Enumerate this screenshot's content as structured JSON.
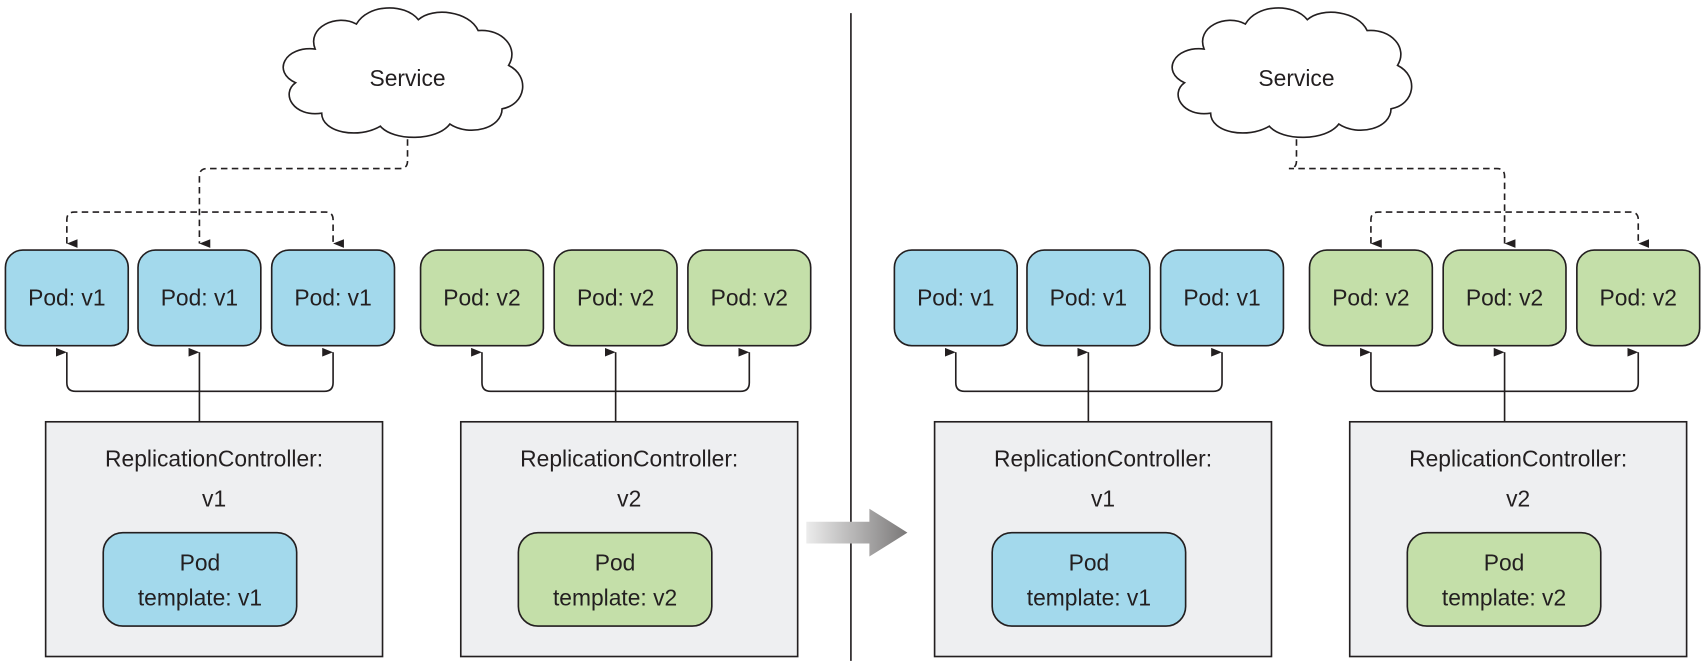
{
  "colors": {
    "v1": "#a3d9ec",
    "v2": "#c4dfa9",
    "controller": "#eeeff1",
    "stroke": "#231f20"
  },
  "panels": [
    {
      "service": {
        "label": "Service"
      },
      "service_targets": "v1",
      "pods": [
        {
          "label": "Pod: v1",
          "version": "v1"
        },
        {
          "label": "Pod: v1",
          "version": "v1"
        },
        {
          "label": "Pod: v1",
          "version": "v1"
        },
        {
          "label": "Pod: v2",
          "version": "v2"
        },
        {
          "label": "Pod: v2",
          "version": "v2"
        },
        {
          "label": "Pod: v2",
          "version": "v2"
        }
      ],
      "controllers": [
        {
          "title": "ReplicationController:",
          "version_label": "v1",
          "version": "v1",
          "template_line1": "Pod",
          "template_line2": "template: v1"
        },
        {
          "title": "ReplicationController:",
          "version_label": "v2",
          "version": "v2",
          "template_line1": "Pod",
          "template_line2": "template: v2"
        }
      ]
    },
    {
      "service": {
        "label": "Service"
      },
      "service_targets": "v2",
      "pods": [
        {
          "label": "Pod: v1",
          "version": "v1"
        },
        {
          "label": "Pod: v1",
          "version": "v1"
        },
        {
          "label": "Pod: v1",
          "version": "v1"
        },
        {
          "label": "Pod: v2",
          "version": "v2"
        },
        {
          "label": "Pod: v2",
          "version": "v2"
        },
        {
          "label": "Pod: v2",
          "version": "v2"
        }
      ],
      "controllers": [
        {
          "title": "ReplicationController:",
          "version_label": "v1",
          "version": "v1",
          "template_line1": "Pod",
          "template_line2": "template: v1"
        },
        {
          "title": "ReplicationController:",
          "version_label": "v2",
          "version": "v2",
          "template_line1": "Pod",
          "template_line2": "template: v2"
        }
      ]
    }
  ]
}
